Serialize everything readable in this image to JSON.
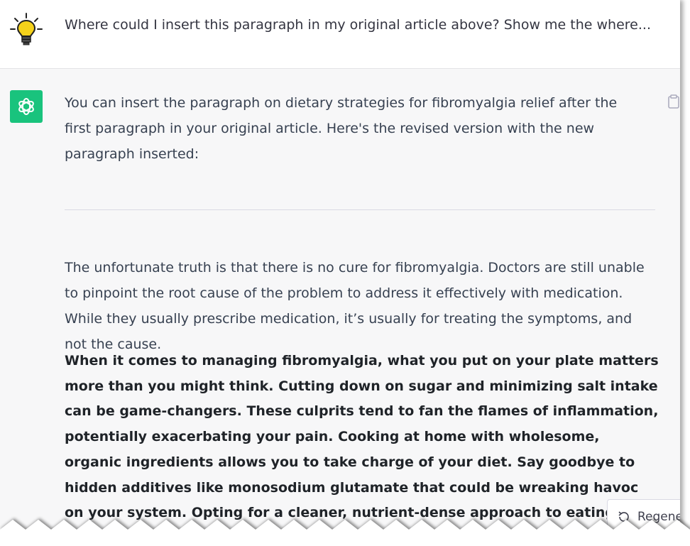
{
  "user_message": {
    "text": "Where could I insert this paragraph in my original article above? Show me the where..."
  },
  "assistant_message": {
    "intro": "You can insert the paragraph on dietary strategies for fibromyalgia relief after the first paragraph in your original article. Here's the revised version with the new paragraph inserted:",
    "paragraph_1": "The unfortunate truth is that there is no cure for fibromyalgia. Doctors are still unable to pinpoint the root cause of the problem to address it effectively with medication. While they usually prescribe medication, it’s usually for treating the symptoms, and not the cause.",
    "paragraph_2": "When it comes to managing fibromyalgia, what you put on your plate matters more than you might think. Cutting down on sugar and minimizing salt intake can be game-changers. These culprits tend to fan the flames of inflammation, potentially exacerbating your pain. Cooking at home with wholesome, organic ingredients allows you to take charge of your diet. Say goodbye to hidden additives like monosodium glutamate that could be wreaking havoc on your system. Opting for a cleaner, nutrient-dense approach to eating might just be the key to easing those fibromyalgia symptoms."
  },
  "regenerate_button": {
    "label": "Regene"
  },
  "icons": {
    "user_avatar": "lightbulb-icon",
    "assistant_avatar": "openai-logo-icon",
    "copy": "clipboard-icon",
    "regenerate": "refresh-icon"
  },
  "colors": {
    "assistant_bg": "#f7f7f8",
    "avatar_green": "#19c37d",
    "bulb_yellow": "#f5d21b"
  }
}
